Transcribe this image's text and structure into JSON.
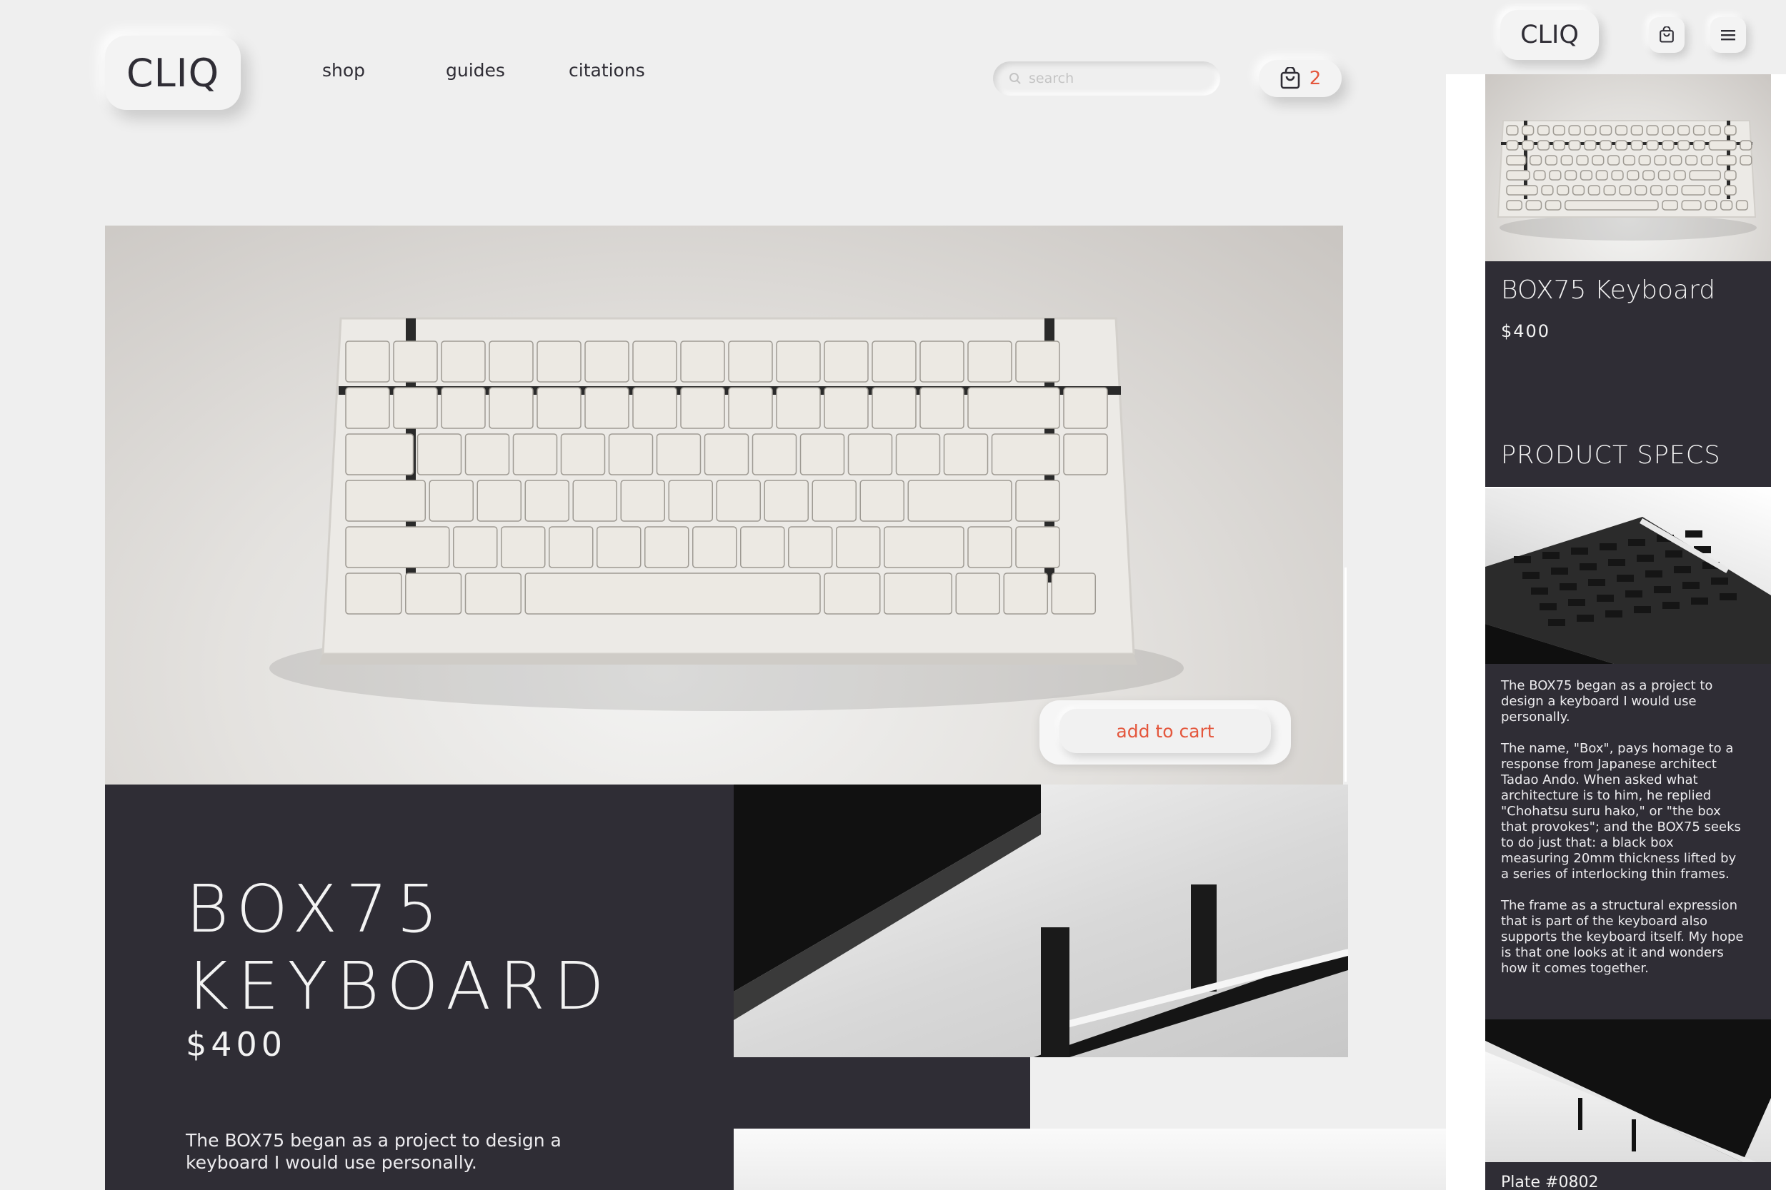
{
  "colors": {
    "background": "#efefef",
    "dark_panel": "#2f2d35",
    "accent": "#e4573d",
    "text_light": "#f3f3f3"
  },
  "brand": {
    "logo": "CLIQ"
  },
  "nav": {
    "links": [
      "shop",
      "guides",
      "citations"
    ],
    "search_placeholder": "search",
    "search_icon": "search-icon",
    "cart_icon": "shopping-bag-icon",
    "cart_count": "2"
  },
  "hero": {
    "image": "box75-keyboard-photo",
    "add_to_cart_label": "add to cart"
  },
  "product": {
    "title_line1": "BOX75",
    "title_line2": "KEYBOARD",
    "price": "$400",
    "description": "The BOX75 began as a project to design a keyboard I would use personally."
  },
  "mobile": {
    "logo": "CLIQ",
    "cart_icon": "shopping-bag-icon",
    "menu_icon": "hamburger-menu-icon",
    "title": "BOX75 Keyboard",
    "price": "$400",
    "specs_heading": "PRODUCT SPECS",
    "paragraphs": [
      "The BOX75 began as a project to design a keyboard I would use personally.",
      "The name, \"Box\", pays homage to a response from Japanese architect Tadao Ando. When asked what architecture is to him, he replied \"Chohatsu suru hako,\" or \"the box that provokes\"; and the BOX75 seeks to do just that: a black box measuring 20mm thickness lifted by a series of interlocking thin frames.",
      "The frame as a structural expression that is part of the keyboard also supports the keyboard itself. My hope is that one looks at it and wonders how it comes together."
    ],
    "plate_label": "Plate #0802"
  }
}
